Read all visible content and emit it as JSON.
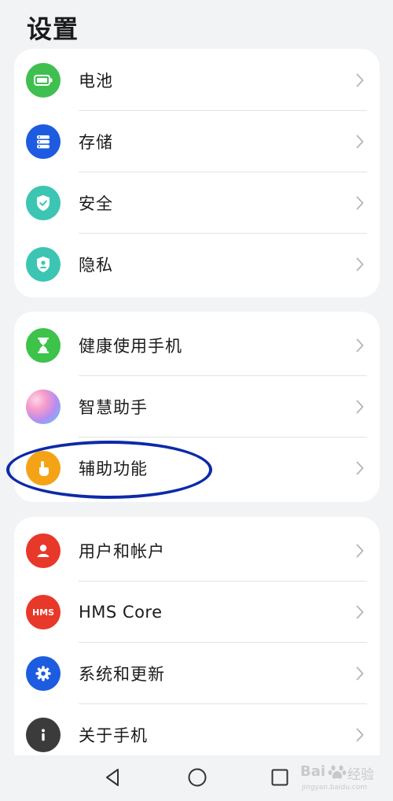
{
  "header": {
    "title": "设置"
  },
  "groups": [
    {
      "items": [
        {
          "label": "电池",
          "icon": "battery-icon",
          "color": "#3fbf4f"
        },
        {
          "label": "存储",
          "icon": "storage-icon",
          "color": "#1d5ce0"
        },
        {
          "label": "安全",
          "icon": "security-shield-icon",
          "color": "#3cc5b3"
        },
        {
          "label": "隐私",
          "icon": "privacy-icon",
          "color": "#3cc5b3"
        }
      ]
    },
    {
      "items": [
        {
          "label": "健康使用手机",
          "icon": "hourglass-icon",
          "color": "#3dc24a"
        },
        {
          "label": "智慧助手",
          "icon": "assistant-orb-icon",
          "color": "#b68cf2"
        },
        {
          "label": "辅助功能",
          "icon": "accessibility-hand-icon",
          "color": "#f5a316"
        }
      ]
    },
    {
      "items": [
        {
          "label": "用户和帐户",
          "icon": "user-icon",
          "color": "#e8382a"
        },
        {
          "label": "HMS Core",
          "icon": "hms-core-icon",
          "color": "#e8382a",
          "icon_text": "HMS"
        },
        {
          "label": "系统和更新",
          "icon": "gear-icon",
          "color": "#1d5ce0"
        },
        {
          "label": "关于手机",
          "icon": "info-icon",
          "color": "#3b3b3b"
        }
      ]
    }
  ],
  "navbar": {
    "back": "back-triangle-icon",
    "home": "home-circle-icon",
    "recents": "recents-square-icon"
  },
  "watermark": {
    "brand": "Bai",
    "paw": "paw-icon",
    "brand2": "经验",
    "url": "jingyan.baidu.com"
  },
  "annotation": {
    "highlight_color": "#0c2aa8"
  }
}
